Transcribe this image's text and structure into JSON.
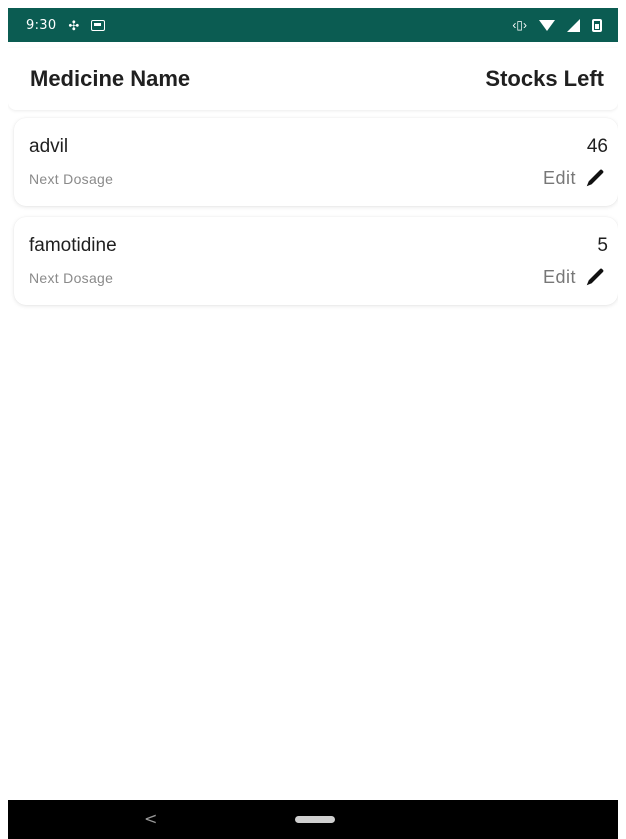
{
  "status_bar": {
    "time": "9:30",
    "background": "#0b5c52",
    "left_icons": [
      "fan-icon",
      "app-notification-icon"
    ],
    "right_icons": [
      "vibrate-icon",
      "wifi-icon",
      "signal-icon",
      "battery-icon"
    ]
  },
  "header": {
    "medicine_name_label": "Medicine Name",
    "stocks_left_label": "Stocks Left"
  },
  "medicines": [
    {
      "name": "advil",
      "stock": "46",
      "subtitle": "Next Dosage",
      "edit_label": "Edit"
    },
    {
      "name": "famotidine",
      "stock": "5",
      "subtitle": "Next Dosage",
      "edit_label": "Edit"
    }
  ],
  "nav_bar": {
    "back_glyph": "<",
    "icons": [
      "back-icon",
      "home-pill-icon"
    ]
  }
}
